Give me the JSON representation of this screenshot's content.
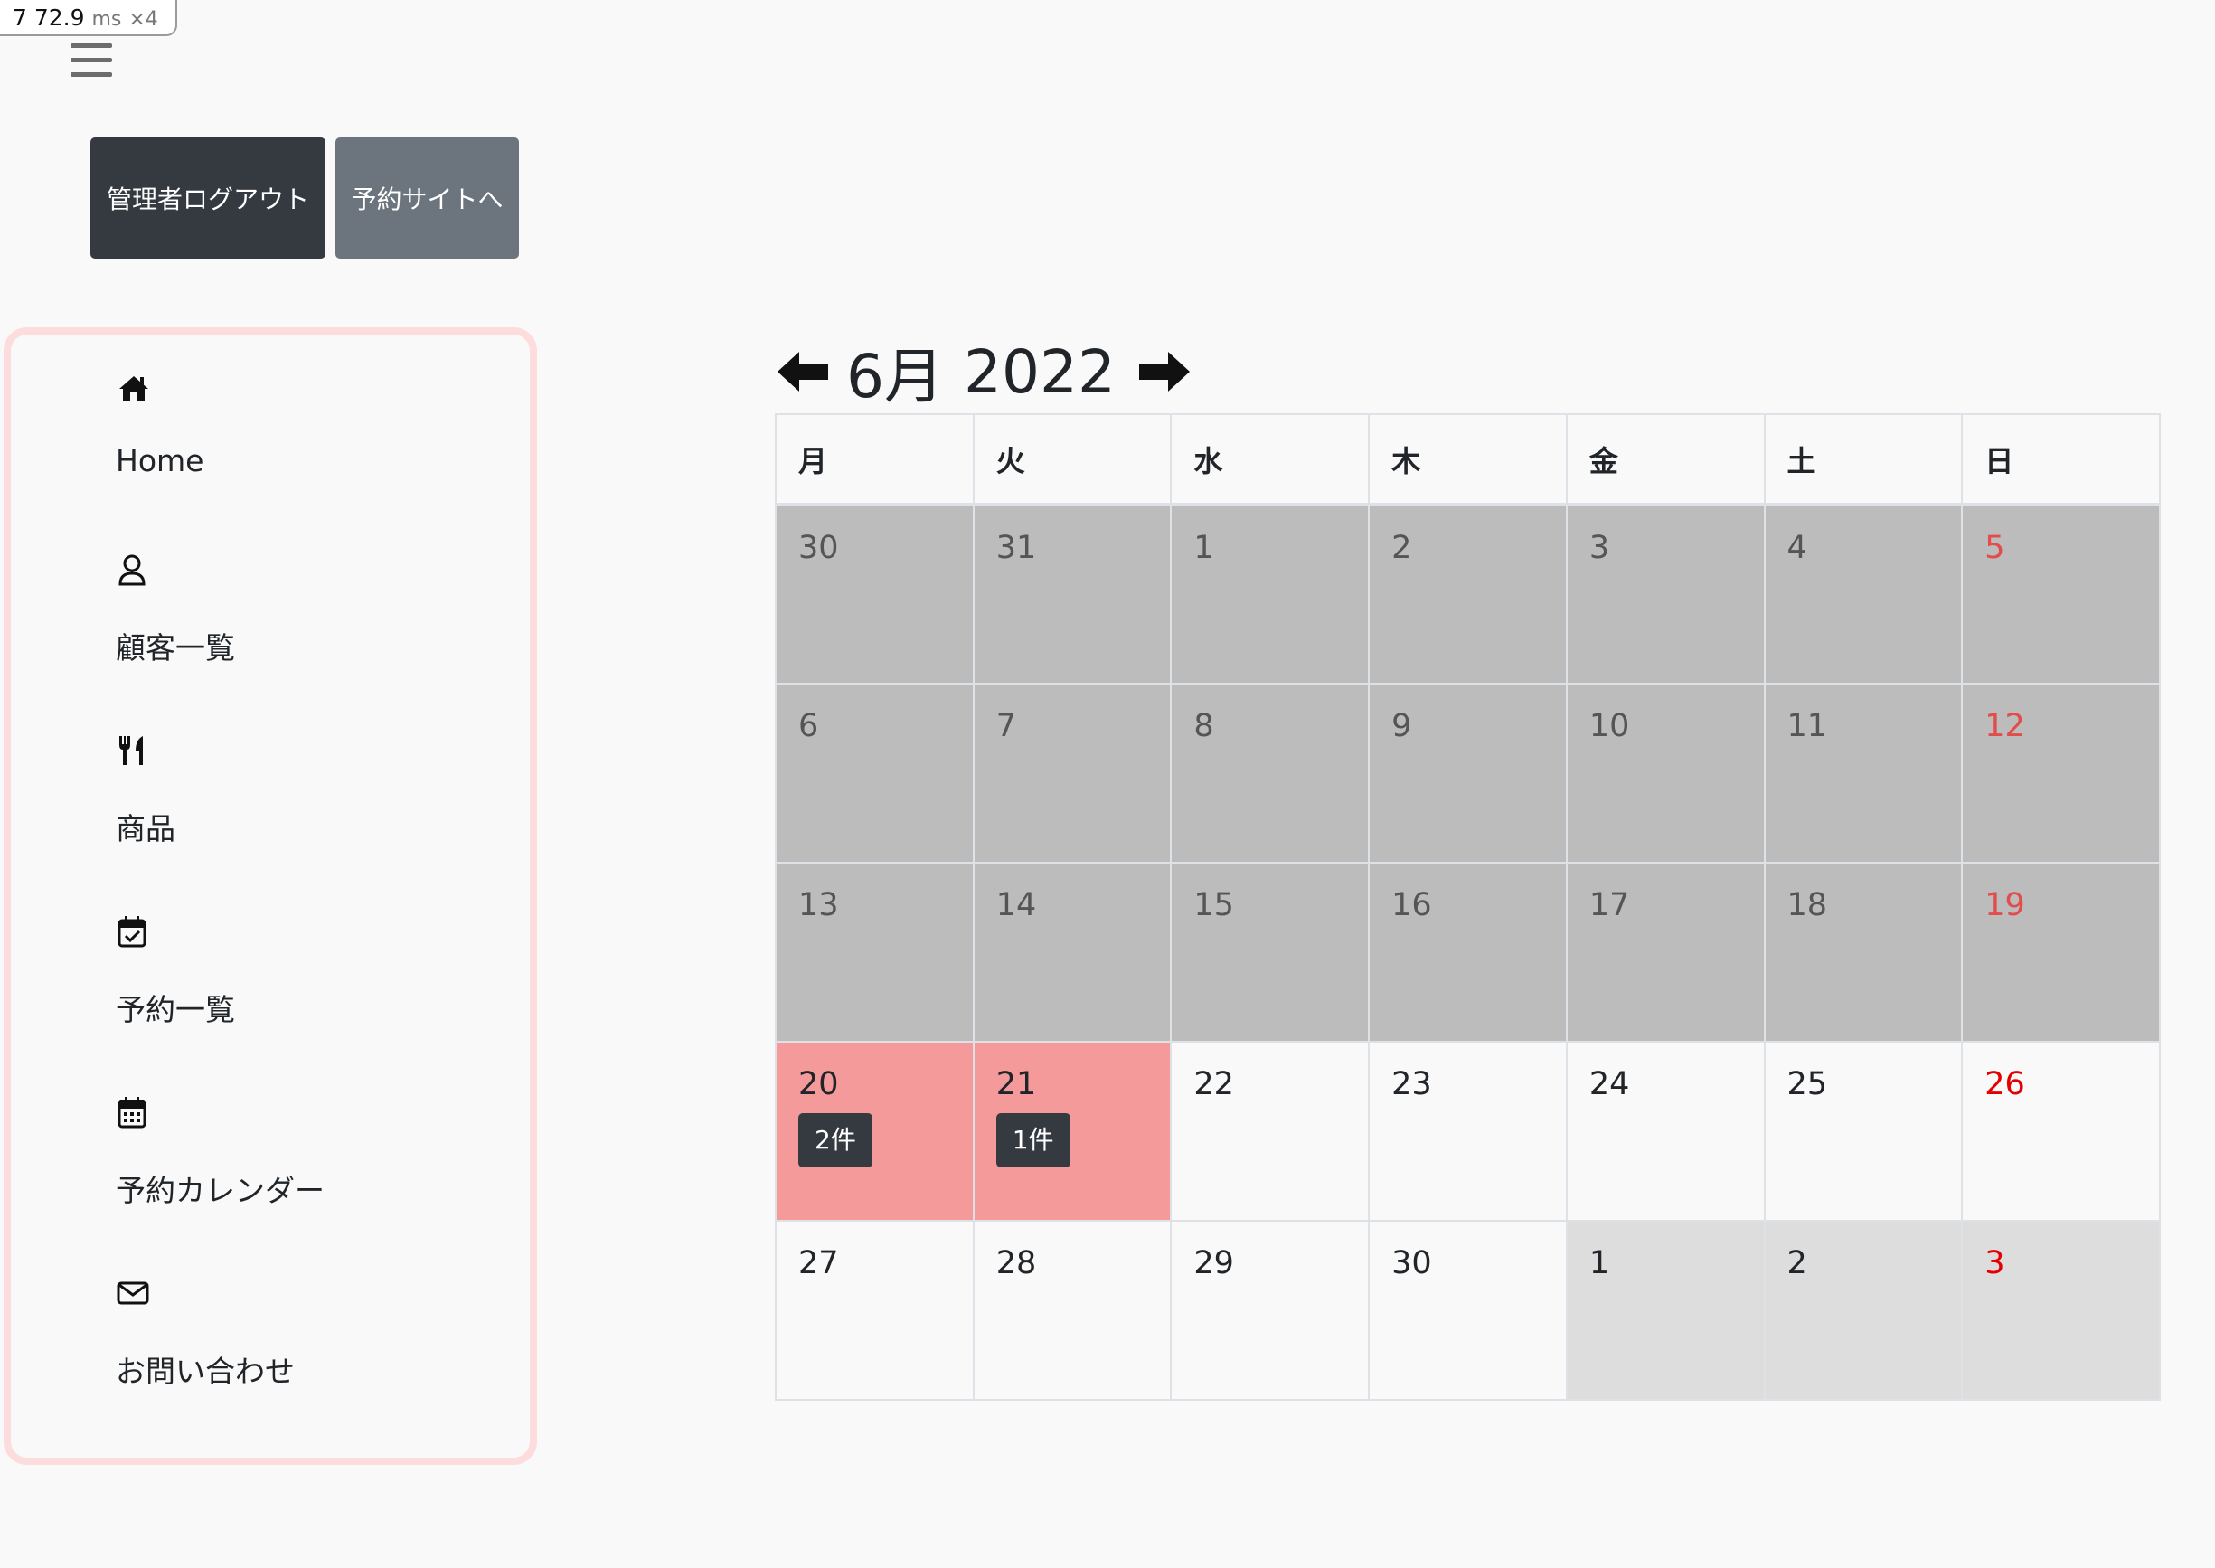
{
  "perf": {
    "count": "7",
    "value": "72.9",
    "unit": "ms",
    "mult": "×4"
  },
  "buttons": {
    "logout": "管理者ログアウト",
    "site": "予約サイトへ"
  },
  "sidebar": {
    "items": [
      {
        "label": "Home",
        "icon": "home-icon"
      },
      {
        "label": "顧客一覧",
        "icon": "user-icon"
      },
      {
        "label": "商品",
        "icon": "utensils-icon"
      },
      {
        "label": "予約一覧",
        "icon": "calendar-check-icon"
      },
      {
        "label": "予約カレンダー",
        "icon": "calendar-icon"
      },
      {
        "label": "お問い合わせ",
        "icon": "envelope-icon"
      }
    ]
  },
  "calendar": {
    "month": "6月",
    "year": "2022",
    "weekdays": [
      "月",
      "火",
      "水",
      "木",
      "金",
      "土",
      "日"
    ],
    "weeks": [
      [
        {
          "d": "30",
          "s": "past"
        },
        {
          "d": "31",
          "s": "past"
        },
        {
          "d": "1",
          "s": "past"
        },
        {
          "d": "2",
          "s": "past"
        },
        {
          "d": "3",
          "s": "past"
        },
        {
          "d": "4",
          "s": "past"
        },
        {
          "d": "5",
          "s": "past"
        }
      ],
      [
        {
          "d": "6",
          "s": "past"
        },
        {
          "d": "7",
          "s": "past"
        },
        {
          "d": "8",
          "s": "past"
        },
        {
          "d": "9",
          "s": "past"
        },
        {
          "d": "10",
          "s": "past"
        },
        {
          "d": "11",
          "s": "past"
        },
        {
          "d": "12",
          "s": "past"
        }
      ],
      [
        {
          "d": "13",
          "s": "past"
        },
        {
          "d": "14",
          "s": "past"
        },
        {
          "d": "15",
          "s": "past"
        },
        {
          "d": "16",
          "s": "past"
        },
        {
          "d": "17",
          "s": "past"
        },
        {
          "d": "18",
          "s": "past"
        },
        {
          "d": "19",
          "s": "past"
        }
      ],
      [
        {
          "d": "20",
          "s": "booked",
          "count": "2件"
        },
        {
          "d": "21",
          "s": "booked",
          "count": "1件"
        },
        {
          "d": "22",
          "s": "normal"
        },
        {
          "d": "23",
          "s": "normal"
        },
        {
          "d": "24",
          "s": "normal"
        },
        {
          "d": "25",
          "s": "normal"
        },
        {
          "d": "26",
          "s": "normal"
        }
      ],
      [
        {
          "d": "27",
          "s": "normal"
        },
        {
          "d": "28",
          "s": "normal"
        },
        {
          "d": "29",
          "s": "normal"
        },
        {
          "d": "30",
          "s": "normal"
        },
        {
          "d": "1",
          "s": "next"
        },
        {
          "d": "2",
          "s": "next"
        },
        {
          "d": "3",
          "s": "next"
        }
      ]
    ]
  },
  "colors": {
    "past_bg": "#bdbcbc",
    "booked_bg": "#f59a9b",
    "next_bg": "#dddddd",
    "sunday": "#e40000",
    "sidebar_border": "#fcdcdc"
  }
}
